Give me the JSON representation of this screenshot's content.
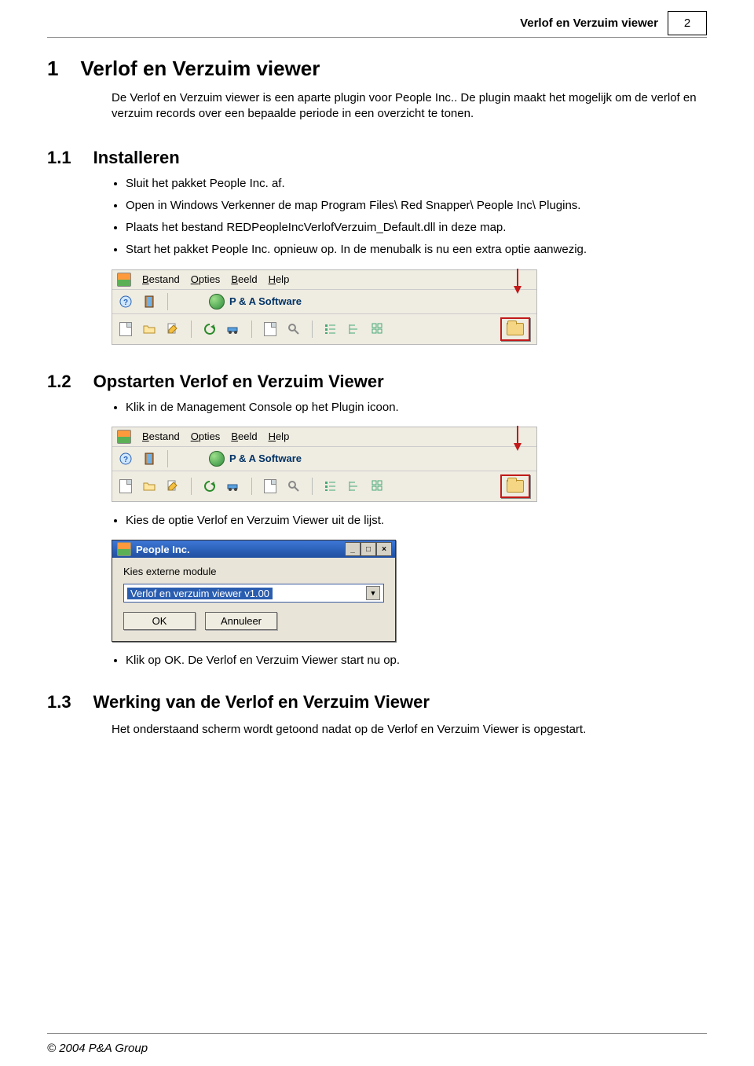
{
  "header": {
    "title": "Verlof en Verzuim viewer",
    "page_number": "2"
  },
  "h1": {
    "num": "1",
    "title": "Verlof en Verzuim viewer"
  },
  "intro": "De Verlof en Verzuim viewer is een aparte plugin voor People Inc.. De plugin maakt het mogelijk om de verlof en verzuim records over een bepaalde periode in een overzicht te tonen.",
  "sec11": {
    "num": "1.1",
    "title": "Installeren",
    "bullets": [
      "Sluit het pakket People Inc. af.",
      "Open in Windows Verkenner de map Program Files\\ Red Snapper\\ People Inc\\ Plugins.",
      "Plaats het bestand REDPeopleIncVerlofVerzuim_Default.dll in deze map.",
      "Start het pakket People Inc. opnieuw op. In de menubalk is nu een extra optie aanwezig."
    ]
  },
  "toolbar": {
    "menu": {
      "bestand": "Bestand",
      "opties": "Opties",
      "beeld": "Beeld",
      "help": "Help"
    },
    "brand": "P & A Software"
  },
  "sec12": {
    "num": "1.2",
    "title": "Opstarten Verlof en Verzuim Viewer",
    "b1": "Klik in de Management Console op het Plugin icoon.",
    "b2": "Kies de optie Verlof en Verzuim Viewer uit de lijst."
  },
  "dialog": {
    "title": "People Inc.",
    "label": "Kies externe module",
    "selected": "Verlof en verzuim viewer v1.00",
    "ok": "OK",
    "cancel": "Annuleer",
    "min": "_",
    "max": "□",
    "close": "×"
  },
  "sec12_b3": "Klik op OK. De Verlof en Verzuim Viewer start nu op.",
  "sec13": {
    "num": "1.3",
    "title": "Werking van de Verlof en Verzuim Viewer",
    "p": "Het onderstaand scherm wordt getoond nadat op de Verlof en Verzuim Viewer is opgestart."
  },
  "footer": "© 2004 P&A Group"
}
